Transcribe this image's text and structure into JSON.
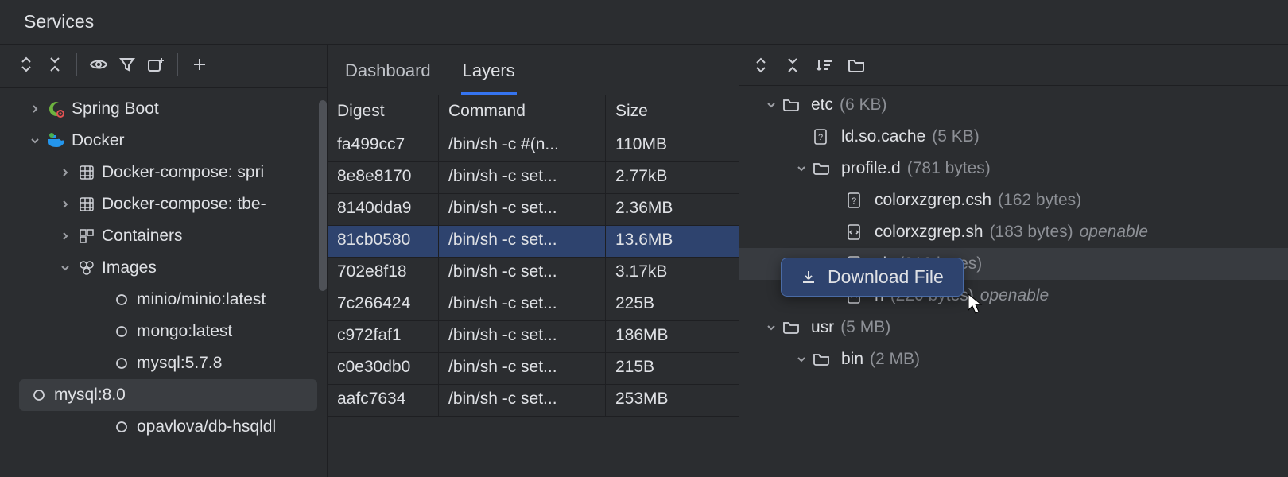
{
  "title": "Services",
  "sidebar": {
    "items": [
      {
        "label": "Spring Boot",
        "icon": "spring",
        "expand": "right",
        "depth": 0
      },
      {
        "label": "Docker",
        "icon": "docker",
        "expand": "down",
        "depth": 0
      },
      {
        "label": "Docker-compose: spri",
        "icon": "grid",
        "expand": "right",
        "depth": 1
      },
      {
        "label": "Docker-compose: tbe-",
        "icon": "grid",
        "expand": "right",
        "depth": 1
      },
      {
        "label": "Containers",
        "icon": "containers",
        "expand": "right",
        "depth": 1
      },
      {
        "label": "Images",
        "icon": "images",
        "expand": "down",
        "depth": 1
      },
      {
        "label": "minio/minio:latest",
        "icon": "circle",
        "depth": 2
      },
      {
        "label": "mongo:latest",
        "icon": "circle",
        "depth": 2
      },
      {
        "label": "mysql:5.7.8",
        "icon": "circle",
        "depth": 2
      },
      {
        "label": "mysql:8.0",
        "icon": "circle",
        "depth": 2,
        "selected": true
      },
      {
        "label": "opavlova/db-hsqldl",
        "icon": "circle",
        "depth": 2
      }
    ]
  },
  "tabs": [
    {
      "label": "Dashboard",
      "active": false
    },
    {
      "label": "Layers",
      "active": true
    }
  ],
  "layers": {
    "columns": [
      "Digest",
      "Command",
      "Size"
    ],
    "rows": [
      {
        "digest": "fa499cc7",
        "command": "/bin/sh -c #(n...",
        "size": "110MB"
      },
      {
        "digest": "8e8e8170",
        "command": "/bin/sh -c set...",
        "size": "2.77kB"
      },
      {
        "digest": "8140dda9",
        "command": "/bin/sh -c set...",
        "size": "2.36MB"
      },
      {
        "digest": "81cb0580",
        "command": "/bin/sh -c set...",
        "size": "13.6MB",
        "selected": true
      },
      {
        "digest": "702e8f18",
        "command": "/bin/sh -c set...",
        "size": "3.17kB"
      },
      {
        "digest": "7c266424",
        "command": "/bin/sh -c set...",
        "size": "225B"
      },
      {
        "digest": "c972faf1",
        "command": "/bin/sh -c set...",
        "size": "186MB"
      },
      {
        "digest": "c0e30db0",
        "command": "/bin/sh -c set...",
        "size": "215B"
      },
      {
        "digest": "aafc7634",
        "command": "/bin/sh -c set...",
        "size": "253MB"
      }
    ]
  },
  "files": [
    {
      "name": "etc",
      "size": "(6 KB)",
      "type": "folder",
      "expand": "down",
      "depth": 0
    },
    {
      "name": "ld.so.cache",
      "size": "(5 KB)",
      "type": "unknown",
      "depth": 1
    },
    {
      "name": "profile.d",
      "size": "(781 bytes)",
      "type": "folder",
      "expand": "down",
      "depth": 1
    },
    {
      "name": "colorxzgrep.csh",
      "size": "(162 bytes)",
      "type": "unknown",
      "depth": 2
    },
    {
      "name": "colorxzgrep.sh",
      "size": "(183 bytes)",
      "type": "script",
      "openable": true,
      "depth": 2
    },
    {
      "name": "sh",
      "size": "(216 bytes)",
      "type": "script",
      "depth": 2,
      "hover": true
    },
    {
      "name": "h",
      "size": "(220 bytes)",
      "type": "script",
      "openable": true,
      "depth": 2
    },
    {
      "name": "usr",
      "size": "(5 MB)",
      "type": "folder",
      "expand": "down",
      "depth": 0
    },
    {
      "name": "bin",
      "size": "(2 MB)",
      "type": "folder",
      "expand": "down",
      "depth": 1
    }
  ],
  "contextMenu": {
    "label": "Download File"
  }
}
